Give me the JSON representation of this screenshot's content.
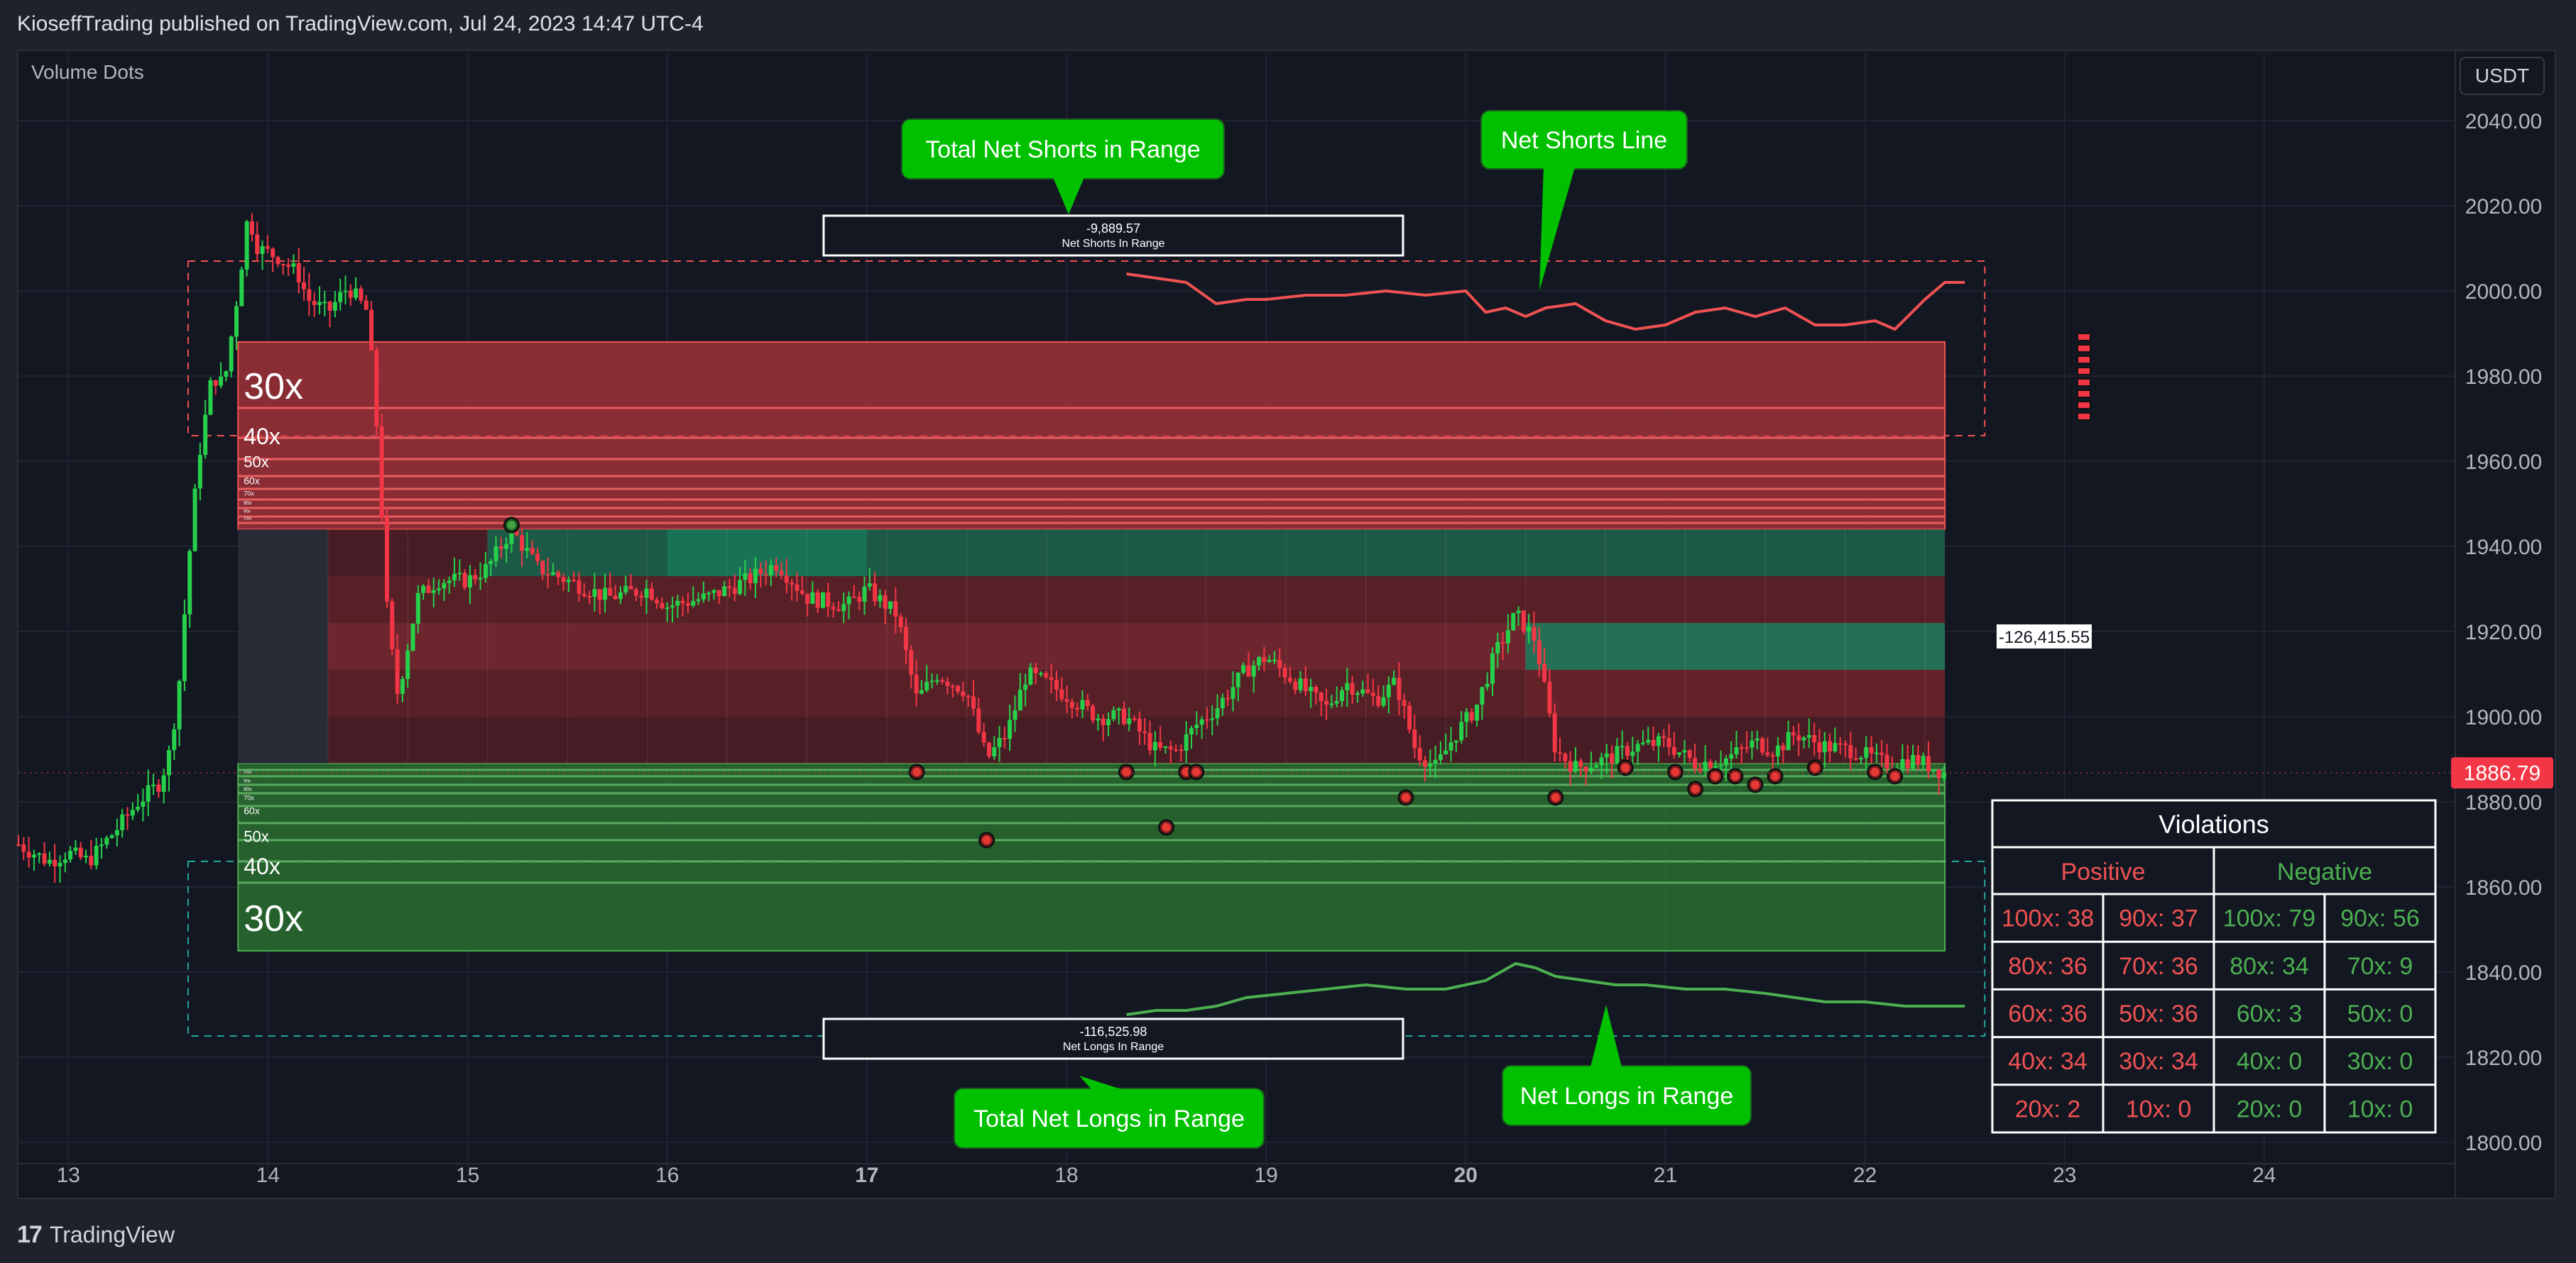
{
  "header": {
    "published": "KioseffTrading published on TradingView.com, Jul 24, 2023 14:47 UTC-4"
  },
  "indicator": {
    "name": "Volume Dots"
  },
  "currency": "USDT",
  "footer": {
    "brand": "TradingView"
  },
  "colors": {
    "background": "#131722",
    "bear": "#f23645",
    "bull": "#089981",
    "green_zone": "#4caf50",
    "red_zone": "#f05252",
    "callout": "#00c000",
    "price_tag": "#f23645"
  },
  "chart_data": {
    "type": "candlestick",
    "symbol_quote": "USDT",
    "ylim": [
      1795,
      2045
    ],
    "y_ticks": [
      2040,
      2020,
      2000,
      1980,
      1960,
      1940,
      1920,
      1900,
      1880,
      1860,
      1840,
      1820,
      1800
    ],
    "y_tick_labels": [
      "2040.00",
      "2020.00",
      "2000.00",
      "1980.00",
      "1960.00",
      "1940.00",
      "1920.00",
      "1900.00",
      "1880.00",
      "1860.00",
      "1840.00",
      "1820.00",
      "1800.00"
    ],
    "x_ticks": [
      13,
      14,
      15,
      16,
      17,
      18,
      19,
      20,
      21,
      22,
      23,
      24
    ],
    "x_tick_labels": [
      "13",
      "14",
      "15",
      "16",
      "17",
      "18",
      "19",
      "20",
      "21",
      "22",
      "23",
      "24"
    ],
    "xlim": [
      12.75,
      24.95
    ],
    "last_price": 1886.79,
    "last_price_label": "1886.79",
    "price_path": [
      [
        12.75,
        1870
      ],
      [
        12.9,
        1866
      ],
      [
        13.0,
        1868
      ],
      [
        13.1,
        1866
      ],
      [
        13.25,
        1874
      ],
      [
        13.35,
        1880
      ],
      [
        13.45,
        1884
      ],
      [
        13.5,
        1890
      ],
      [
        13.55,
        1905
      ],
      [
        13.6,
        1935
      ],
      [
        13.65,
        1960
      ],
      [
        13.72,
        1980
      ],
      [
        13.78,
        1978
      ],
      [
        13.85,
        2000
      ],
      [
        13.9,
        2018
      ],
      [
        13.95,
        2010
      ],
      [
        14.05,
        2008
      ],
      [
        14.15,
        2004
      ],
      [
        14.2,
        1998
      ],
      [
        14.3,
        1995
      ],
      [
        14.4,
        2001
      ],
      [
        14.5,
        1995
      ],
      [
        14.55,
        1965
      ],
      [
        14.6,
        1922
      ],
      [
        14.65,
        1905
      ],
      [
        14.75,
        1928
      ],
      [
        14.85,
        1932
      ],
      [
        15.0,
        1932
      ],
      [
        15.1,
        1935
      ],
      [
        15.22,
        1944
      ],
      [
        15.35,
        1935
      ],
      [
        15.5,
        1932
      ],
      [
        15.7,
        1928
      ],
      [
        15.9,
        1930
      ],
      [
        16.0,
        1926
      ],
      [
        16.2,
        1928
      ],
      [
        16.4,
        1932
      ],
      [
        16.55,
        1936
      ],
      [
        16.7,
        1928
      ],
      [
        16.9,
        1926
      ],
      [
        17.0,
        1930
      ],
      [
        17.15,
        1924
      ],
      [
        17.25,
        1904
      ],
      [
        17.35,
        1910
      ],
      [
        17.5,
        1906
      ],
      [
        17.6,
        1890
      ],
      [
        17.7,
        1896
      ],
      [
        17.8,
        1910
      ],
      [
        17.9,
        1908
      ],
      [
        18.0,
        1905
      ],
      [
        18.15,
        1900
      ],
      [
        18.3,
        1900
      ],
      [
        18.45,
        1892
      ],
      [
        18.55,
        1892
      ],
      [
        18.65,
        1898
      ],
      [
        18.75,
        1902
      ],
      [
        18.9,
        1911
      ],
      [
        19.0,
        1914
      ],
      [
        19.15,
        1908
      ],
      [
        19.3,
        1902
      ],
      [
        19.4,
        1908
      ],
      [
        19.55,
        1904
      ],
      [
        19.65,
        1908
      ],
      [
        19.75,
        1892
      ],
      [
        19.85,
        1888
      ],
      [
        19.95,
        1896
      ],
      [
        20.05,
        1902
      ],
      [
        20.15,
        1915
      ],
      [
        20.25,
        1924
      ],
      [
        20.35,
        1918
      ],
      [
        20.45,
        1892
      ],
      [
        20.55,
        1888
      ],
      [
        20.7,
        1890
      ],
      [
        20.85,
        1893
      ],
      [
        21.0,
        1894
      ],
      [
        21.15,
        1889
      ],
      [
        21.3,
        1890
      ],
      [
        21.45,
        1894
      ],
      [
        21.55,
        1892
      ],
      [
        21.65,
        1896
      ],
      [
        21.8,
        1893
      ],
      [
        21.95,
        1892
      ],
      [
        22.1,
        1889
      ],
      [
        22.25,
        1890
      ],
      [
        22.4,
        1886.79
      ]
    ],
    "zones": {
      "short_liquidation": {
        "top": 1988,
        "bottom": 1944,
        "labels": [
          "30x",
          "40x",
          "50x",
          "60x",
          "70x",
          "80x",
          "90x",
          "100x"
        ]
      },
      "long_liquidation": {
        "top": 1889,
        "bottom": 1845,
        "labels": [
          "30x",
          "40x",
          "50x",
          "60x",
          "70x",
          "80x",
          "90x",
          "100x"
        ]
      }
    },
    "net_shorts": {
      "value_label": "-9,889.57",
      "caption": "Net Shorts In Range",
      "path": [
        [
          18.3,
          2004
        ],
        [
          18.45,
          2003
        ],
        [
          18.6,
          2002
        ],
        [
          18.75,
          1997
        ],
        [
          18.9,
          1998
        ],
        [
          19.0,
          1998
        ],
        [
          19.2,
          1999
        ],
        [
          19.4,
          1999
        ],
        [
          19.6,
          2000
        ],
        [
          19.8,
          1999
        ],
        [
          20.0,
          2000
        ],
        [
          20.1,
          1995
        ],
        [
          20.2,
          1996
        ],
        [
          20.3,
          1994
        ],
        [
          20.4,
          1996
        ],
        [
          20.55,
          1997
        ],
        [
          20.7,
          1993
        ],
        [
          20.85,
          1991
        ],
        [
          21.0,
          1992
        ],
        [
          21.15,
          1995
        ],
        [
          21.3,
          1996
        ],
        [
          21.45,
          1994
        ],
        [
          21.6,
          1996
        ],
        [
          21.75,
          1992
        ],
        [
          21.9,
          1992
        ],
        [
          22.05,
          1993
        ],
        [
          22.15,
          1991
        ],
        [
          22.3,
          1998
        ],
        [
          22.4,
          2002
        ],
        [
          22.5,
          2002
        ]
      ]
    },
    "net_longs": {
      "value_label": "-116,525.98",
      "caption": "Net Longs In Range",
      "path": [
        [
          18.3,
          1830
        ],
        [
          18.45,
          1831
        ],
        [
          18.6,
          1831
        ],
        [
          18.75,
          1832
        ],
        [
          18.9,
          1834
        ],
        [
          19.1,
          1835
        ],
        [
          19.3,
          1836
        ],
        [
          19.5,
          1837
        ],
        [
          19.7,
          1836
        ],
        [
          19.9,
          1836
        ],
        [
          20.1,
          1838
        ],
        [
          20.25,
          1842
        ],
        [
          20.35,
          1841
        ],
        [
          20.45,
          1839
        ],
        [
          20.6,
          1838
        ],
        [
          20.75,
          1837
        ],
        [
          20.9,
          1837
        ],
        [
          21.1,
          1836
        ],
        [
          21.3,
          1836
        ],
        [
          21.5,
          1835
        ],
        [
          21.65,
          1834
        ],
        [
          21.8,
          1833
        ],
        [
          22.0,
          1833
        ],
        [
          22.2,
          1832
        ],
        [
          22.4,
          1832
        ],
        [
          22.5,
          1832
        ]
      ]
    },
    "vertical_profile_value": "-126,415.55",
    "volume_dots": [
      [
        15.22,
        1945,
        "green"
      ],
      [
        17.25,
        1887,
        "red"
      ],
      [
        17.6,
        1871,
        "red"
      ],
      [
        18.3,
        1887,
        "red"
      ],
      [
        18.5,
        1874,
        "red"
      ],
      [
        18.6,
        1887,
        "red"
      ],
      [
        18.65,
        1887,
        "red"
      ],
      [
        19.7,
        1881,
        "red"
      ],
      [
        20.45,
        1881,
        "red"
      ],
      [
        20.8,
        1888,
        "red"
      ],
      [
        21.05,
        1887,
        "red"
      ],
      [
        21.15,
        1883,
        "red"
      ],
      [
        21.25,
        1886,
        "red"
      ],
      [
        21.35,
        1886,
        "red"
      ],
      [
        21.45,
        1884,
        "red"
      ],
      [
        21.55,
        1886,
        "red"
      ],
      [
        21.75,
        1888,
        "red"
      ],
      [
        22.05,
        1887,
        "red"
      ],
      [
        22.15,
        1886,
        "red"
      ]
    ]
  },
  "callouts": [
    {
      "text": "Total Net Shorts in Range"
    },
    {
      "text": "Net Shorts Line"
    },
    {
      "text": "Total Net Longs in Range"
    },
    {
      "text": "Net Longs in Range"
    }
  ],
  "violations": {
    "title": "Violations",
    "headers": [
      "Positive",
      "Negative"
    ],
    "rows": [
      [
        "100x: 38",
        "90x: 37",
        "100x: 79",
        "90x: 56"
      ],
      [
        "80x: 36",
        "70x: 36",
        "80x: 34",
        "70x: 9"
      ],
      [
        "60x: 36",
        "50x: 36",
        "60x: 3",
        "50x: 0"
      ],
      [
        "40x: 34",
        "30x: 34",
        "40x: 0",
        "30x: 0"
      ],
      [
        "20x: 2",
        "10x: 0",
        "20x: 0",
        "10x: 0"
      ]
    ]
  }
}
